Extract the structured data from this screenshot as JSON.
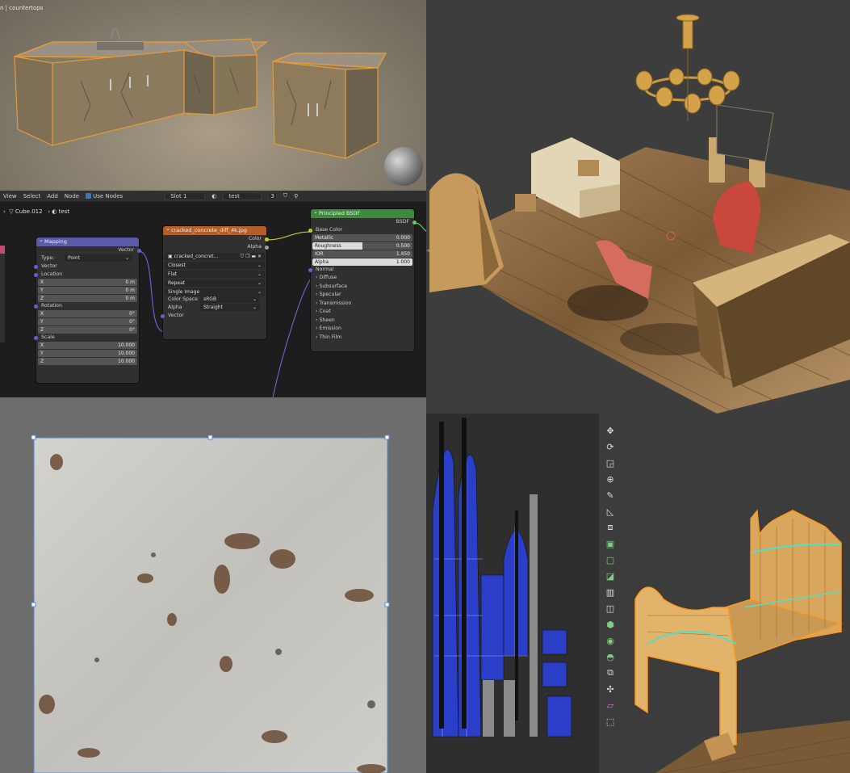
{
  "viewport_top_left": {
    "breadcrumb": "n | countertops"
  },
  "node_editor": {
    "menu": [
      "View",
      "Select",
      "Add",
      "Node"
    ],
    "use_nodes_label": "Use Nodes",
    "slot": "Slot 1",
    "material_name": "test",
    "user_count": "3",
    "breadcrumb_object": "Cube.012",
    "breadcrumb_material": "test",
    "mapping": {
      "title": "Mapping",
      "output": "Vector",
      "type_label": "Type:",
      "type_value": "Point",
      "vector_label": "Vector",
      "location_label": "Location",
      "location": [
        [
          "X",
          "0 m"
        ],
        [
          "Y",
          "0 m"
        ],
        [
          "Z",
          "0 m"
        ]
      ],
      "rotation_label": "Rotation",
      "rotation": [
        [
          "X",
          "0°"
        ],
        [
          "Y",
          "0°"
        ],
        [
          "Z",
          "0°"
        ]
      ],
      "scale_label": "Scale",
      "scale": [
        [
          "X",
          "10.000"
        ],
        [
          "Y",
          "10.000"
        ],
        [
          "Z",
          "10.000"
        ]
      ]
    },
    "image_texture": {
      "title": "cracked_concrete_diff_4k.jpg",
      "out_color": "Color",
      "out_alpha": "Alpha",
      "image_name": "cracked_concret...",
      "interpolation": "Closest",
      "projection": "Flat",
      "extension": "Repeat",
      "source": "Single Image",
      "color_space_label": "Color Space",
      "color_space": "sRGB",
      "alpha_label": "Alpha",
      "alpha_mode": "Straight",
      "in_vector": "Vector"
    },
    "bsdf": {
      "title": "Principled BSDF",
      "output": "BSDF",
      "base_color": "Base Color",
      "metallic_label": "Metallic",
      "metallic": "0.000",
      "roughness_label": "Roughness",
      "roughness": "0.500",
      "ior_label": "IOR",
      "ior": "1.450",
      "alpha_label": "Alpha",
      "alpha": "1.000",
      "normal": "Normal",
      "panels": [
        "Diffuse",
        "Subsurface",
        "Specular",
        "Transmission",
        "Coat",
        "Sheen",
        "Emission",
        "Thin Film"
      ]
    }
  },
  "toolbar_icons": [
    "cursor-icon",
    "move-icon",
    "rotate-icon",
    "scale-icon",
    "transform-icon",
    "annotate-icon",
    "measure-icon",
    "add-cube-icon",
    "extrude-icon",
    "inset-icon",
    "bevel-icon",
    "loop-cut-icon",
    "knife-icon",
    "poly-build-icon",
    "spin-icon",
    "smooth-icon",
    "edge-slide-icon",
    "shrink-icon",
    "shear-icon",
    "rip-icon"
  ]
}
